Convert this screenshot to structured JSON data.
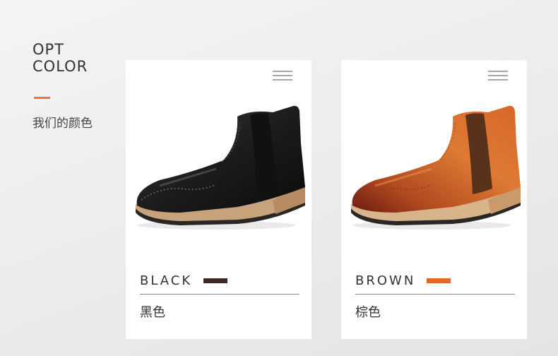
{
  "heading": {
    "line1": "OPT",
    "line2": "COLOR"
  },
  "subtitle": "我们的颜色",
  "colors": {
    "accent": "#e07a3c",
    "background": "#ececed",
    "card": "#ffffff"
  },
  "cards": [
    {
      "name_en": "BLACK",
      "name_cn": "黑色",
      "swatch_color": "#3b2a22",
      "image": "black-chelsea-brogue-boot",
      "menu_icon": "hamburger-menu-icon"
    },
    {
      "name_en": "BROWN",
      "name_cn": "棕色",
      "swatch_color": "#e0672a",
      "image": "brown-chelsea-brogue-boot",
      "menu_icon": "hamburger-menu-icon"
    }
  ]
}
